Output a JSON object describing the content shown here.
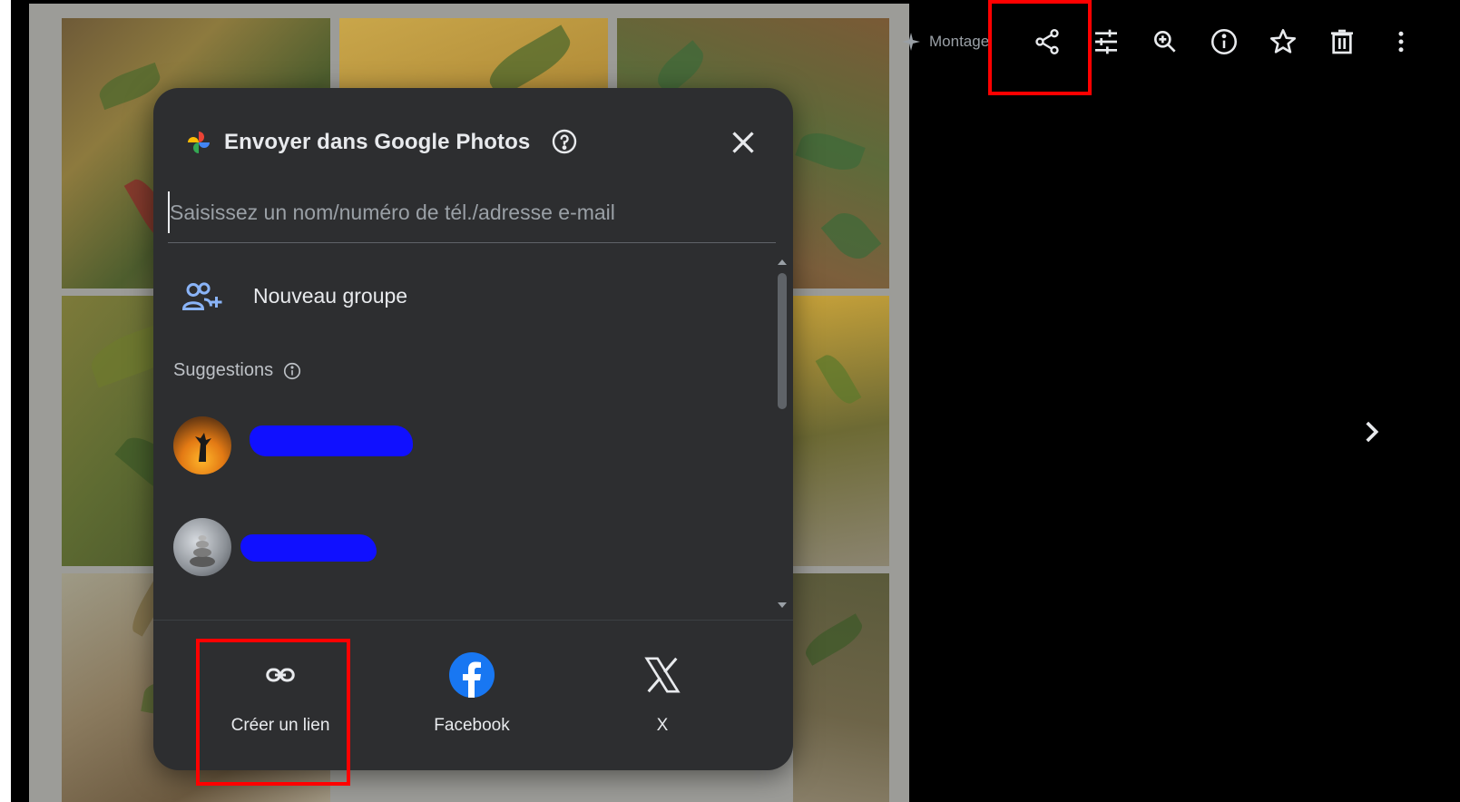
{
  "toolbar": {
    "montage_label": "Montage",
    "buttons": [
      "share-icon",
      "tune-icon",
      "zoom-in-icon",
      "info-icon",
      "star-icon",
      "delete-icon",
      "more-vert-icon"
    ]
  },
  "dialog": {
    "title": "Envoyer dans Google Photos",
    "recipient_placeholder": "Saisissez un nom/numéro de tél./adresse e-mail",
    "recipient_value": "",
    "new_group_label": "Nouveau groupe",
    "suggestions_label": "Suggestions",
    "share_targets": {
      "link_label": "Créer un lien",
      "facebook_label": "Facebook",
      "x_label": "X"
    }
  },
  "colors": {
    "highlight": "#ff0000",
    "dialog_bg": "#2d2e30",
    "redaction": "#1010ff",
    "facebook": "#1877f2"
  }
}
